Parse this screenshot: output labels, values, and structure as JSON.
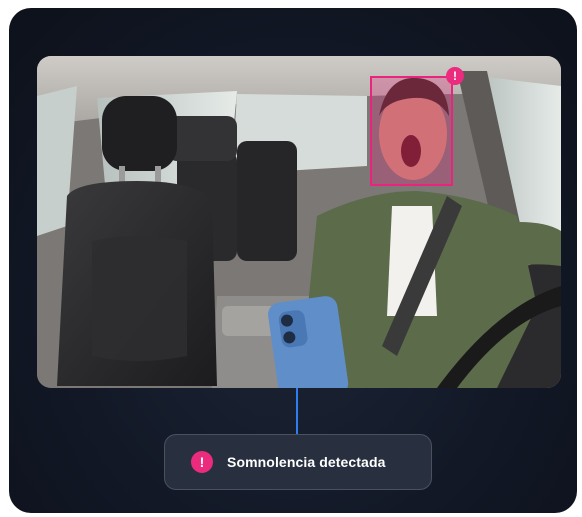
{
  "alert": {
    "label": "Somnolencia detectada",
    "icon": "exclamation-icon",
    "color": "#EA2B7E"
  },
  "face_marker": {
    "icon": "exclamation-icon",
    "color": "#E8247D"
  },
  "connector_color": "#2F7EF0"
}
